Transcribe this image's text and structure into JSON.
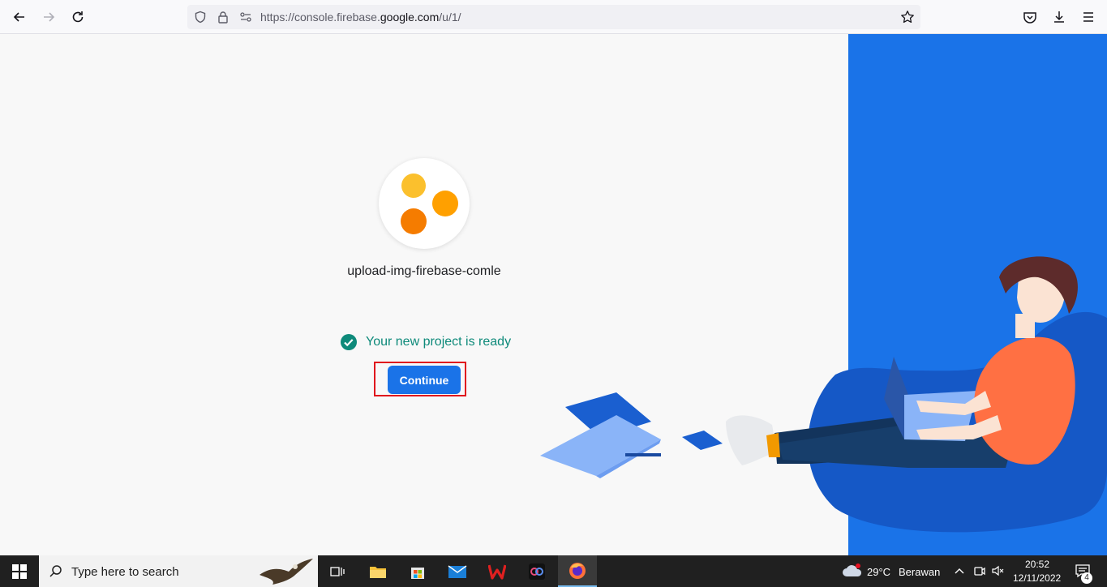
{
  "browser": {
    "url_prefix": "https://console.firebase.",
    "url_domain": "google.com",
    "url_suffix": "/u/1/"
  },
  "page": {
    "project_name": "upload-img-firebase-comle",
    "status_text": "Your new project is ready",
    "continue_label": "Continue"
  },
  "colors": {
    "accent": "#1a73e8",
    "success": "#0e8a7a",
    "highlight": "#e0161d"
  },
  "taskbar": {
    "search_placeholder": "Type here to search",
    "weather_temp": "29°C",
    "weather_desc": "Berawan",
    "time": "20:52",
    "date": "12/11/2022",
    "notification_count": "4"
  }
}
